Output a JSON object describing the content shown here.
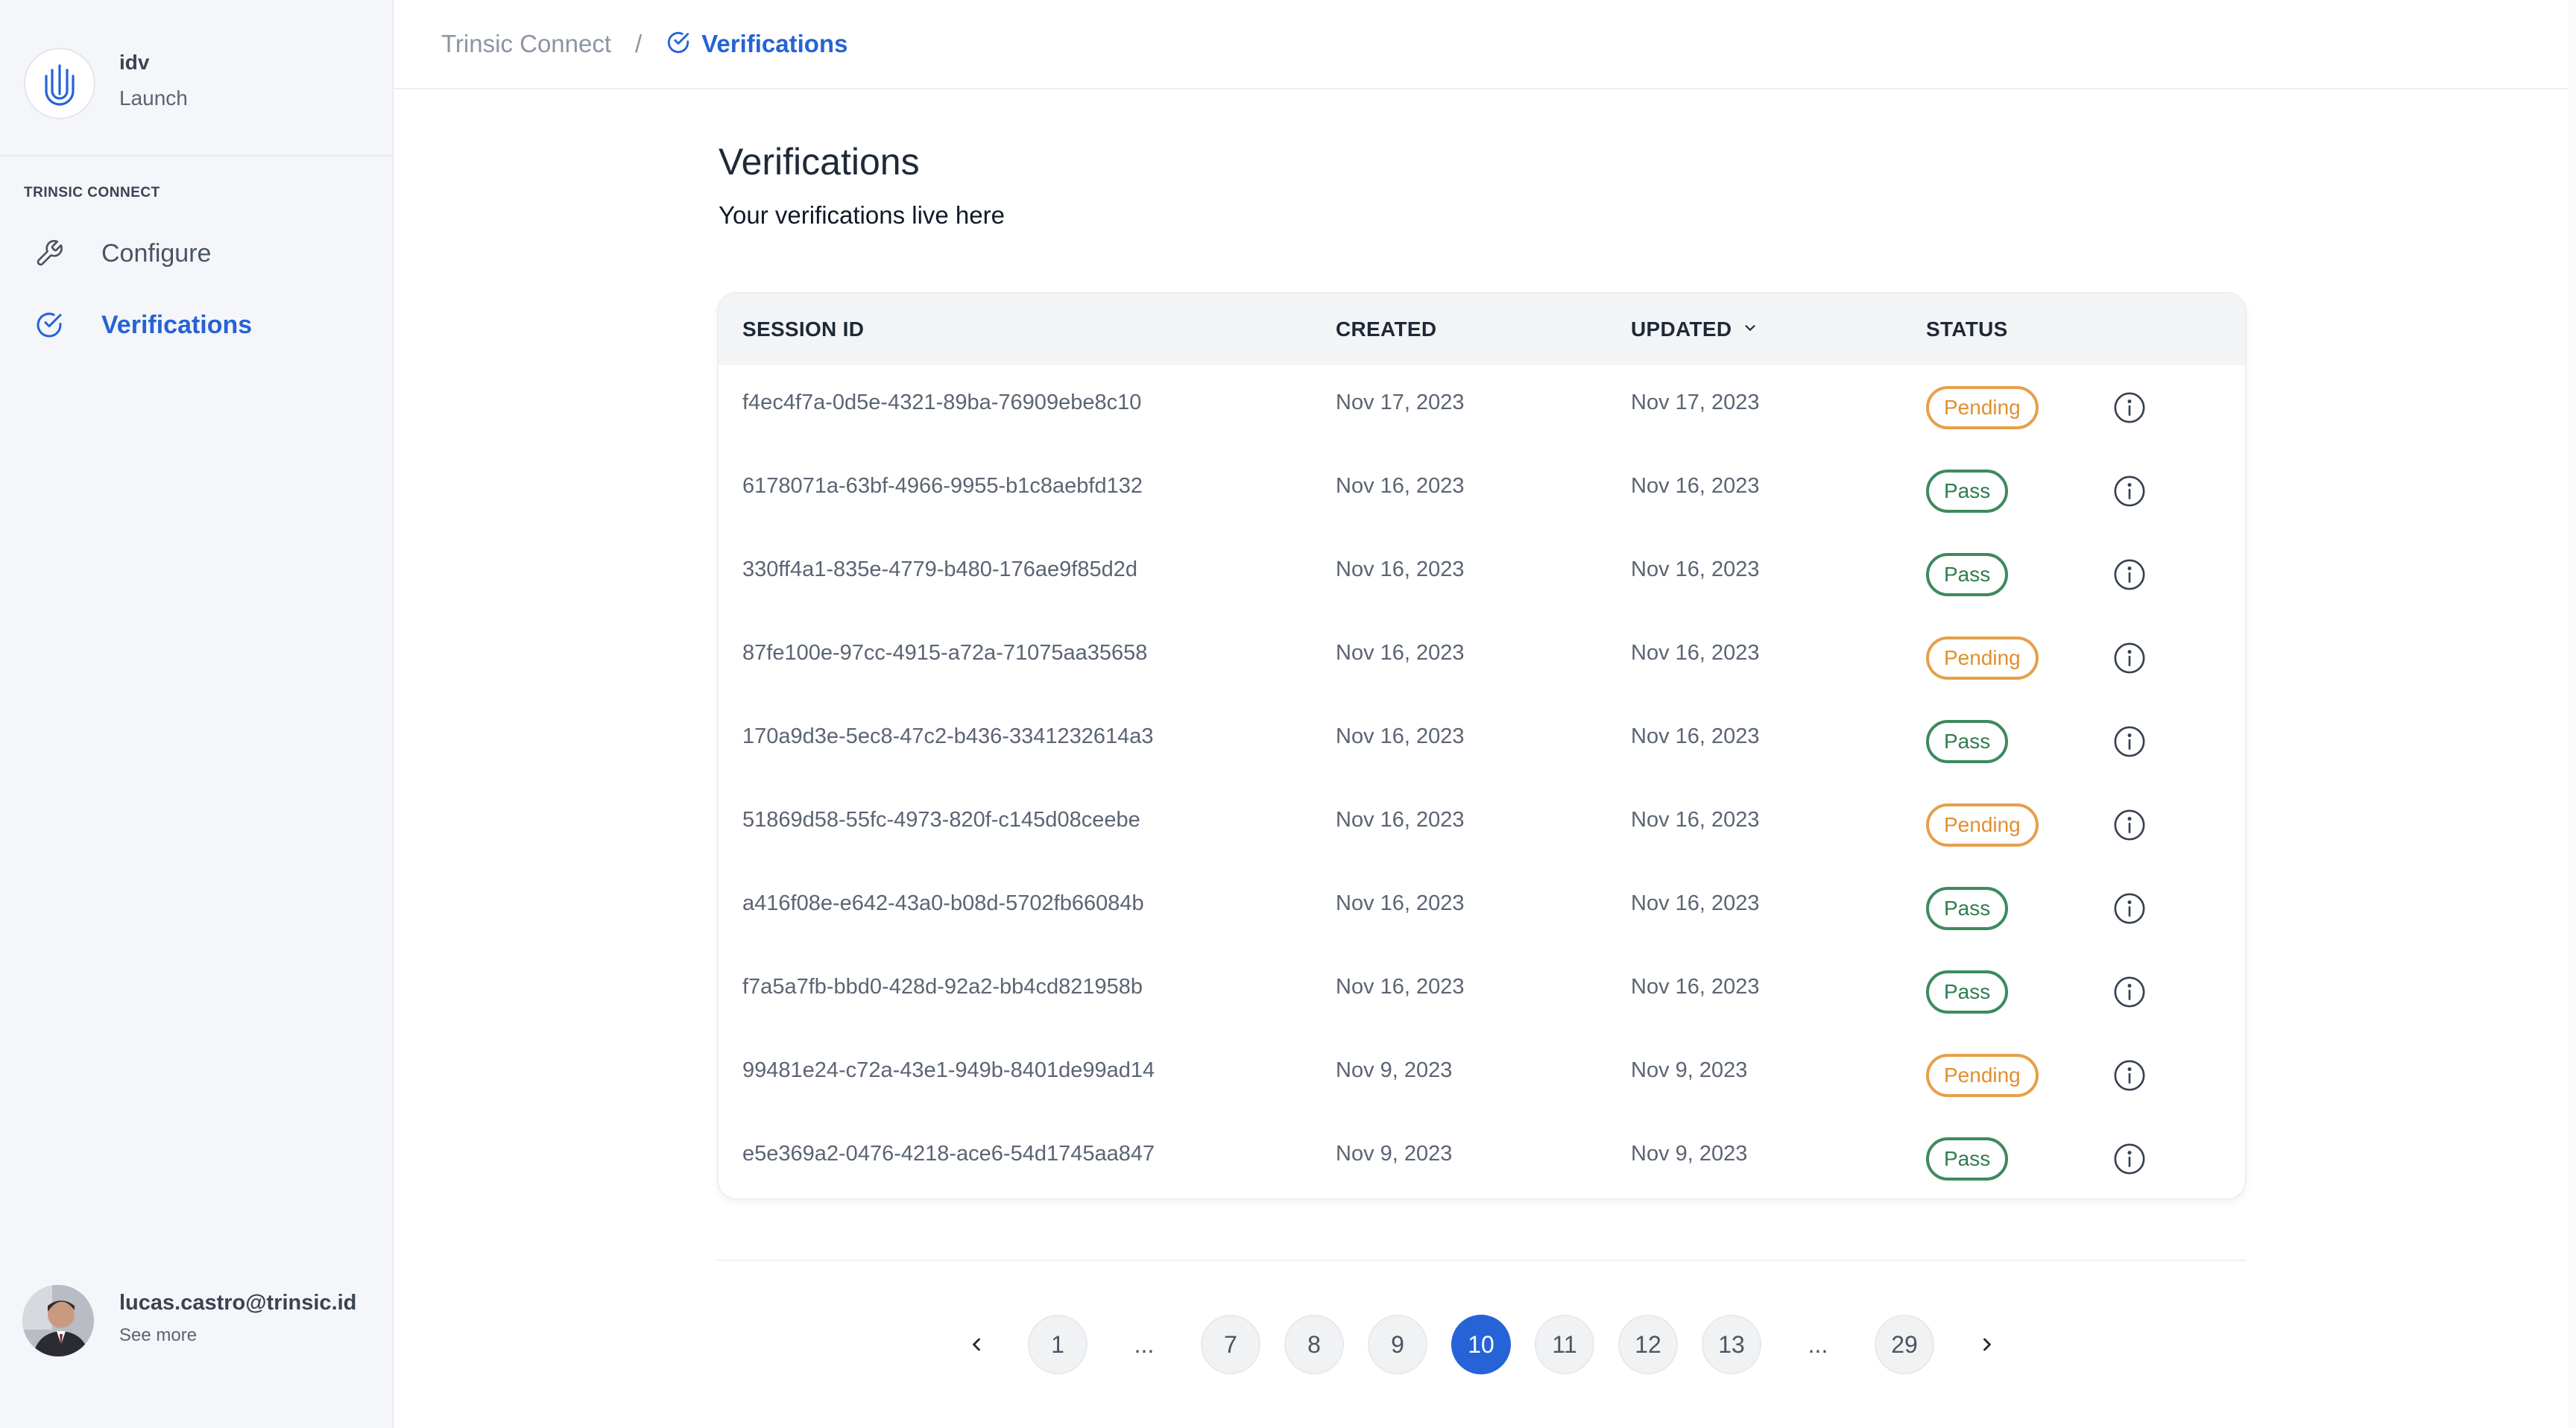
{
  "org": {
    "name": "idv",
    "subtitle": "Launch"
  },
  "sidebar": {
    "section_title": "TRINSIC CONNECT",
    "items": [
      {
        "label": "Configure",
        "icon": "wrench-icon",
        "active": false
      },
      {
        "label": "Verifications",
        "icon": "check-circle-icon",
        "active": true
      }
    ]
  },
  "user": {
    "email": "lucas.castro@trinsic.id",
    "more": "See more"
  },
  "breadcrumb": {
    "root": "Trinsic Connect",
    "separator": "/",
    "current": "Verifications"
  },
  "page": {
    "title": "Verifications",
    "subtitle": "Your verifications live here"
  },
  "table": {
    "columns": [
      "SESSION ID",
      "CREATED",
      "UPDATED",
      "STATUS"
    ],
    "sort_column": "UPDATED",
    "rows": [
      {
        "session_id": "f4ec4f7a-0d5e-4321-89ba-76909ebe8c10",
        "created": "Nov 17, 2023",
        "updated": "Nov 17, 2023",
        "status": "Pending"
      },
      {
        "session_id": "6178071a-63bf-4966-9955-b1c8aebfd132",
        "created": "Nov 16, 2023",
        "updated": "Nov 16, 2023",
        "status": "Pass"
      },
      {
        "session_id": "330ff4a1-835e-4779-b480-176ae9f85d2d",
        "created": "Nov 16, 2023",
        "updated": "Nov 16, 2023",
        "status": "Pass"
      },
      {
        "session_id": "87fe100e-97cc-4915-a72a-71075aa35658",
        "created": "Nov 16, 2023",
        "updated": "Nov 16, 2023",
        "status": "Pending"
      },
      {
        "session_id": "170a9d3e-5ec8-47c2-b436-3341232614a3",
        "created": "Nov 16, 2023",
        "updated": "Nov 16, 2023",
        "status": "Pass"
      },
      {
        "session_id": "51869d58-55fc-4973-820f-c145d08ceebe",
        "created": "Nov 16, 2023",
        "updated": "Nov 16, 2023",
        "status": "Pending"
      },
      {
        "session_id": "a416f08e-e642-43a0-b08d-5702fb66084b",
        "created": "Nov 16, 2023",
        "updated": "Nov 16, 2023",
        "status": "Pass"
      },
      {
        "session_id": "f7a5a7fb-bbd0-428d-92a2-bb4cd821958b",
        "created": "Nov 16, 2023",
        "updated": "Nov 16, 2023",
        "status": "Pass"
      },
      {
        "session_id": "99481e24-c72a-43e1-949b-8401de99ad14",
        "created": "Nov 9, 2023",
        "updated": "Nov 9, 2023",
        "status": "Pending"
      },
      {
        "session_id": "e5e369a2-0476-4218-ace6-54d1745aa847",
        "created": "Nov 9, 2023",
        "updated": "Nov 9, 2023",
        "status": "Pass"
      }
    ]
  },
  "pagination": {
    "current": "10",
    "items": [
      "1",
      "...",
      "7",
      "8",
      "9",
      "10",
      "11",
      "12",
      "13",
      "...",
      "29"
    ]
  },
  "colors": {
    "accent": "#2563d6",
    "pending": "#e0902e",
    "pass": "#2f7d4f"
  }
}
